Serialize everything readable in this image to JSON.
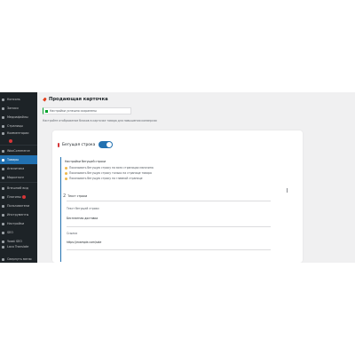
{
  "sidebar": {
    "items": [
      {
        "label": "Консоль",
        "active": false,
        "badge": false
      },
      {
        "label": "Записи",
        "active": false,
        "badge": false
      },
      {
        "label": "Медиафайлы",
        "active": false,
        "badge": false
      },
      {
        "label": "Страницы",
        "active": false,
        "badge": false
      },
      {
        "label": "Комментарии",
        "active": false,
        "badge": true
      },
      {
        "label": "WooCommerce",
        "active": false,
        "badge": false
      },
      {
        "label": "Товары",
        "active": true,
        "badge": false
      },
      {
        "label": "Аналитика",
        "active": false,
        "badge": false
      },
      {
        "label": "Маркетинг",
        "active": false,
        "badge": false
      },
      {
        "label": "Внешний вид",
        "active": false,
        "badge": false
      },
      {
        "label": "Плагины",
        "active": false,
        "badge": true
      },
      {
        "label": "Пользователи",
        "active": false,
        "badge": false
      },
      {
        "label": "Инструменты",
        "active": false,
        "badge": false
      },
      {
        "label": "Настройки",
        "active": false,
        "badge": false
      },
      {
        "label": "SEO",
        "active": false,
        "badge": false
      },
      {
        "label": "Yoast SEO",
        "active": false,
        "badge": false
      },
      {
        "label": "Loco Translate",
        "active": false,
        "badge": false
      },
      {
        "label": "Свернуть меню",
        "active": false,
        "badge": false
      }
    ]
  },
  "page": {
    "title": "Продающая карточка",
    "notice": "Настройки успешно сохранены",
    "description": "Настройте отображение блоков в карточке товара для повышения конверсии"
  },
  "card": {
    "title": "Бегущая строка",
    "toggle_on": true,
    "section_title": "Настройки бегущей строки",
    "options": [
      "Показывать бегущую строку на всех страницах магазина",
      "Показывать бегущую строку только на странице товара",
      "Показывать бегущую строку на главной странице"
    ],
    "step_number": "2",
    "step_title": "Текст строки",
    "field1_label": "Текст бегущей строки",
    "field1_value": "Бесплатная доставка",
    "field2_label": "Ссылка",
    "field2_value": "https://example.com/sale"
  },
  "colors": {
    "sidebar_bg": "#1d2327",
    "accent": "#2271b1",
    "success": "#00a32a",
    "option_dot": "#f0b849"
  }
}
